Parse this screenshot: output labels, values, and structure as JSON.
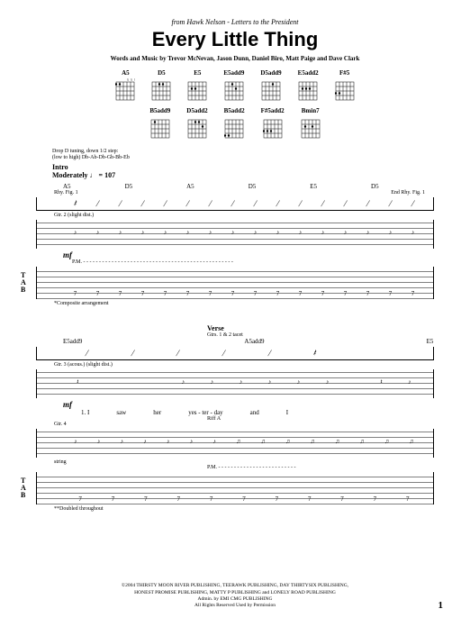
{
  "source": {
    "prefix": "from Hawk Nelson - ",
    "album": "Letters to the President"
  },
  "title": "Every Little Thing",
  "credits": "Words and Music by Trevor McNevan, Jason Dunn, Daniel Biro, Matt Paige and Dave Clark",
  "chord_diagrams_row1": [
    "A5",
    "D5",
    "E5",
    "E5add9",
    "D5add9",
    "E5add2",
    "F#5"
  ],
  "chord_diagrams_row2": [
    "B5add9",
    "D5add2",
    "B5add2",
    "F#5add2",
    "Bmin7"
  ],
  "tuning_note": "Drop D tuning, down 1/2 step:\n(low to high) Db-Ab-Db-Gb-Bb-Eb",
  "intro": {
    "section": "Intro",
    "tempo_text": "Moderately",
    "tempo_bpm": 107,
    "rhy_fig": "Rhy. Fig. 1",
    "end_rhy_fig": "End Rhy. Fig. 1",
    "chord_seq": [
      "A5",
      "D5",
      "A5",
      "D5",
      "E5",
      "D5"
    ],
    "gtr2_label": "Gtr. 2 (slight dist.)",
    "dynamic": "mf",
    "tab_notes_line1": [
      "7",
      "7",
      "7",
      "7",
      "7",
      "7",
      "7",
      "7",
      "7",
      "7",
      "7",
      "7",
      "7",
      "7",
      "7",
      "7"
    ],
    "pm": "P.M.",
    "footnote": "*Composite arrangement"
  },
  "verse": {
    "section": "Verse",
    "gtrs_tacet": "Gtrs. 1 & 2 tacet",
    "chord_seq": [
      "E5add9",
      "A5add9",
      "E5"
    ],
    "gtr3_label": "Gtr. 3 (acous.)",
    "gtr3_note": "(slight dist.)",
    "dynamic": "mf",
    "riff_label": "Riff A",
    "gtr4_label": "Gtr. 4",
    "pm": "P.M.",
    "lyrics": [
      "1. I",
      "saw",
      "her",
      "yes - ter - day",
      "and",
      "I"
    ],
    "string_label": "string",
    "tab_bottom": [
      "7",
      "7",
      "7",
      "7",
      "7",
      "7",
      "7",
      "7",
      "7",
      "7",
      "7"
    ],
    "footnote": "**Doubled throughout"
  },
  "copyright": {
    "line1": "©2004 THIRSTY MOON RIVER PUBLISHING, TEERAWK PUBLISHING, DAY THIRTYSIX PUBLISHING,",
    "line2": "HONEST PROMISE PUBLISHING, MATTY P PUBLISHING and LONELY ROAD PUBLISHING",
    "line3": "Admin. by EMI CMG PUBLISHING",
    "line4": "All Rights Reserved   Used by Permission"
  },
  "page_number": "1"
}
